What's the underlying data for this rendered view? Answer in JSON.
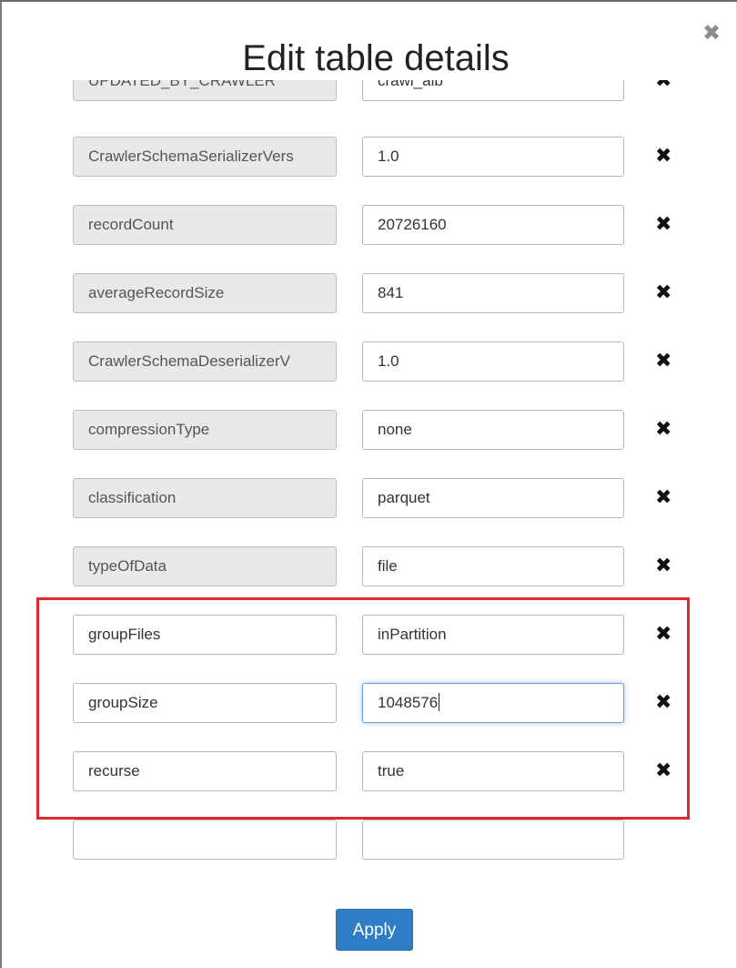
{
  "modal": {
    "title": "Edit table details",
    "close_glyph": "✖",
    "apply_label": "Apply"
  },
  "rows": [
    {
      "key": "UPDATED_BY_CRAWLER",
      "value": "crawl_alb",
      "key_editable": false
    },
    {
      "key": "CrawlerSchemaSerializerVers",
      "value": "1.0",
      "key_editable": false
    },
    {
      "key": "recordCount",
      "value": "20726160",
      "key_editable": false
    },
    {
      "key": "averageRecordSize",
      "value": "841",
      "key_editable": false
    },
    {
      "key": "CrawlerSchemaDeserializerV",
      "value": "1.0",
      "key_editable": false
    },
    {
      "key": "compressionType",
      "value": "none",
      "key_editable": false
    },
    {
      "key": "classification",
      "value": "parquet",
      "key_editable": false
    },
    {
      "key": "typeOfData",
      "value": "file",
      "key_editable": false
    },
    {
      "key": "groupFiles",
      "value": "inPartition",
      "key_editable": true
    },
    {
      "key": "groupSize",
      "value": "1048576",
      "key_editable": true
    },
    {
      "key": "recurse",
      "value": "true",
      "key_editable": true
    },
    {
      "key": "",
      "value": "",
      "key_editable": true
    }
  ],
  "delete_glyph": "✖",
  "colors": {
    "highlight": "#e0282c",
    "apply_bg": "#2f7dc6",
    "readonly_key_bg": "#e9e9e9",
    "focus_ring": "#66a3e0"
  }
}
